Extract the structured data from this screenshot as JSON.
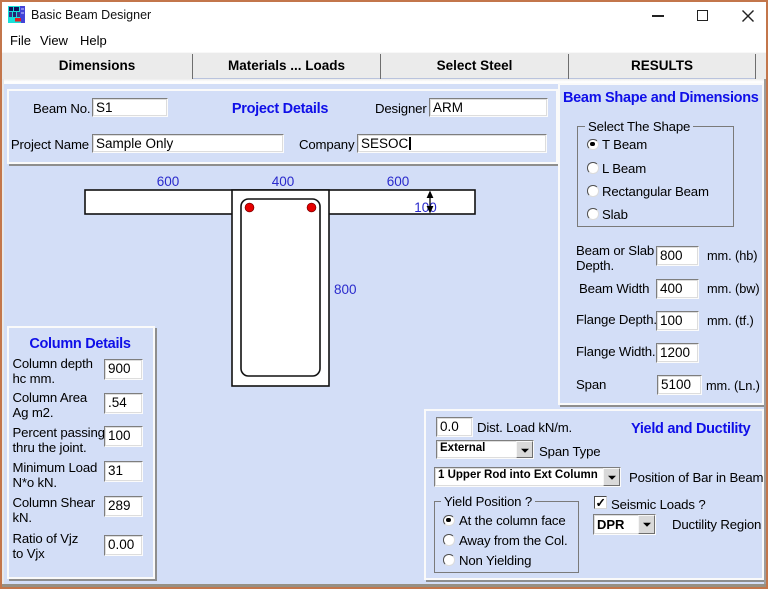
{
  "window": {
    "title": "Basic Beam Designer",
    "controls": {
      "minimize": "minimize",
      "maximize": "maximize",
      "close": "close"
    }
  },
  "menu": {
    "items": [
      {
        "label": "File"
      },
      {
        "label": "View"
      },
      {
        "label": "Help"
      }
    ]
  },
  "tabs": {
    "items": [
      {
        "label": "Dimensions",
        "active": true
      },
      {
        "label": "Materials ... Loads",
        "active": false
      },
      {
        "label": "Select Steel",
        "active": false
      },
      {
        "label": "RESULTS",
        "active": false
      }
    ]
  },
  "project": {
    "title": "Project Details",
    "beam_no_label": "Beam No.",
    "beam_no_value": "S1",
    "designer_label": "Designer",
    "designer_value": "ARM",
    "project_name_label": "Project Name",
    "project_name_value": "Sample Only",
    "company_label": "Company",
    "company_value": "SESOC"
  },
  "shape_panel": {
    "title": "Beam Shape and Dimensions",
    "group_label": "Select The Shape",
    "options": [
      {
        "label": "T Beam",
        "selected": true
      },
      {
        "label": "L Beam",
        "selected": false
      },
      {
        "label": "Rectangular Beam",
        "selected": false
      },
      {
        "label": "Slab",
        "selected": false
      }
    ],
    "fields": [
      {
        "label": "Beam or Slab Depth.",
        "value": "800",
        "unit": "mm. (hb)"
      },
      {
        "label": "Beam Width",
        "value": "400",
        "unit": "mm. (bw)"
      },
      {
        "label": "Flange Depth.",
        "value": "100",
        "unit": "mm. (tf.)"
      },
      {
        "label": "Flange Width.",
        "value": "1200",
        "unit": ""
      },
      {
        "label": "Span",
        "value": "5100",
        "unit": "mm. (Ln.)"
      }
    ]
  },
  "column_panel": {
    "title": "Column Details",
    "fields": [
      {
        "label": "Column depth hc mm.",
        "value": "900"
      },
      {
        "label": "Column Area Ag m2.",
        "value": ".54"
      },
      {
        "label": "Percent passing thru the joint.",
        "value": "100"
      },
      {
        "label": "Minimum Load N*o kN.",
        "value": "31"
      },
      {
        "label": "Column Shear kN.",
        "value": "289"
      },
      {
        "label": "Ratio of Vjz to Vjx",
        "value": "0.00"
      }
    ]
  },
  "yield_panel": {
    "title": "Yield and Ductility",
    "dist_load_value": "0.0",
    "dist_load_label": "Dist. Load kN/m.",
    "span_type_value": "External",
    "span_type_label": "Span Type",
    "bar_position_value": "1 Upper Rod into Ext Column",
    "bar_position_label": "Position of Bar in Beam",
    "yield_group_label": "Yield Position ?",
    "yield_options": [
      {
        "label": "At the column face",
        "selected": true
      },
      {
        "label": "Away from the Col.",
        "selected": false
      },
      {
        "label": "Non Yielding",
        "selected": false
      }
    ],
    "seismic_label": "Seismic Loads ?",
    "seismic_checked": true,
    "ductility_value": "DPR",
    "ductility_label": "Ductility Region"
  },
  "drawing": {
    "dim_flange_left": "600",
    "dim_web_width": "400",
    "dim_flange_right": "600",
    "dim_flange_depth": "100",
    "dim_beam_depth": "800"
  },
  "colors": {
    "window_border": "#c3764b",
    "page_background": "#d3def7",
    "heading_blue": "#0f0fe8",
    "dimension_blue": "#2a2acc",
    "rebar_red": "#e60000"
  }
}
